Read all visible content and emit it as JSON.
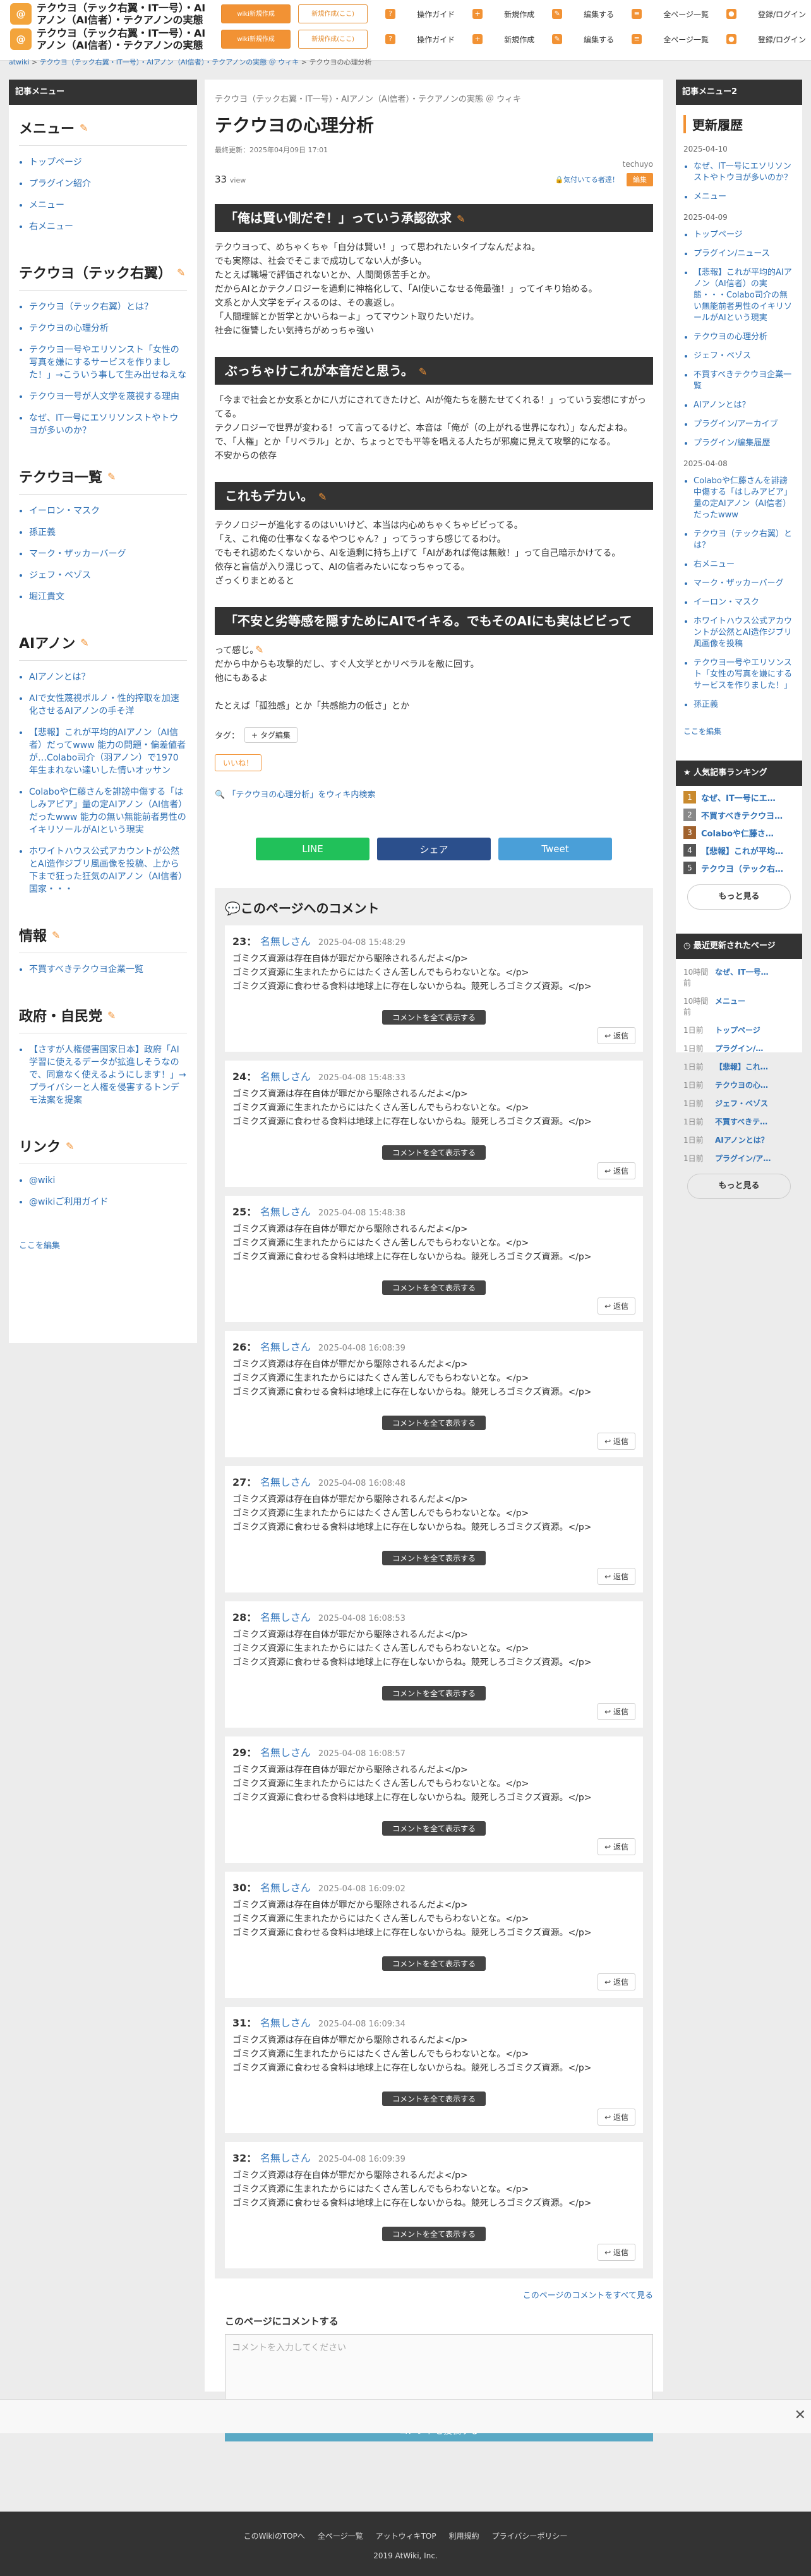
{
  "header": {
    "title": "テクウヨ（テック右翼・IT一号）・AIアノン（AI信者）・テクアノンの実態 ＠ ウィキ",
    "btn1": "wiki新規作成",
    "btn2": "新規作成(ここ)",
    "nav": [
      {
        "label": "操作ガイド",
        "icon": "guide-icon",
        "glyph": "?"
      },
      {
        "label": "新規作成",
        "icon": "plus-icon",
        "glyph": "+"
      },
      {
        "label": "編集する",
        "icon": "edit-icon",
        "glyph": "✎"
      },
      {
        "label": "全ページ一覧",
        "icon": "list-icon",
        "glyph": "≡"
      },
      {
        "label": "登録/ログイン",
        "icon": "user-icon",
        "glyph": "●"
      }
    ]
  },
  "breadcrumb": {
    "root": "atwiki",
    "wiki": "テクウヨ（テック右翼・IT一号）・AIアノン（AI信者）・テクアノンの実態 ＠ ウィキ",
    "page": "テクウヨの心理分析"
  },
  "lside": {
    "head": "記事メニュー",
    "sections": [
      {
        "title": "メニュー",
        "items": [
          "トップページ",
          "プラグイン紹介",
          "メニュー",
          "右メニュー"
        ]
      },
      {
        "title": "テクウヨ（テック右翼）",
        "items": [
          "テクウヨ（テック右翼）とは？",
          "テクウヨの心理分析",
          "テクウヨ一号やエリソンスト「女性の写真を嫌にするサービスを作りました！」→こういう事して生み出せねえな",
          "テクウヨ一号が人文学を蔑視する理由",
          "なぜ、IT一号にエソリソンストやトウヨが多いのか？"
        ]
      },
      {
        "title": "テクウヨ一覧",
        "items": [
          "イーロン・マスク",
          "孫正義",
          "マーク・ザッカーバーグ",
          "ジェフ・ベゾス",
          "堀江貴文"
        ]
      },
      {
        "title": "AIアノン",
        "items": [
          "AIアノンとは？",
          "AIで女性蔑視ポルノ・性的搾取を加速化させるAIアノンの手そ洋",
          "【悲報】これが平均的AIアノン（AI信者）だってwww 能力の問題・偏差値者が…Colabo司介（羽アノン）で1970年生まれない達いした情いオッサン",
          "Colaboや仁藤さんを誹謗中傷する「はしみアビア」量の定AIアノン（AI信者）だったwww 能力の無い無能前者男性のイキリソールがAIという現実",
          "ホワイトハウス公式アカウントが公然とAI造作ジブリ風画像を投稿、上から下まで狂った狂気のAIアノン（AI信者）国家・・・"
        ]
      },
      {
        "title": "情報",
        "items": [
          "不買すべきテクウヨ企業一覧"
        ]
      },
      {
        "title": "政府・自民党",
        "items": [
          "【さすが人権侵害国家日本】政府「AI学習に使えるデータが拡進しそうなので、同意なく使えるようにします！」→プライバシーと人権を侵害するトンデモ法案を提案"
        ]
      },
      {
        "title": "リンク",
        "items": [
          "@wiki",
          "@wikiご利用ガイド"
        ]
      }
    ],
    "edit": "ここを編集"
  },
  "main": {
    "path": "テクウヨ（テック右翼・IT一号）・AIアノン（AI信者）・テクアノンの実態 ＠ ウィキ",
    "title": "テクウヨの心理分析",
    "updated": "最終更新：2025年04月09日 17:01",
    "author": "techuyo",
    "views": "33",
    "views_unit": "view",
    "like_notice": "気付いてる者達！",
    "edit": "編集",
    "sections": [
      {
        "h": "「俺は賢い側だぞ！」っていう承認欲求",
        "p": [
          "テクウヨって、めちゃくちゃ「自分は賢い！」って思われたいタイプなんだよね。",
          "でも実際は、社会でそこまで成功してない人が多い。",
          "たとえば職場で評価されないとか、人間関係苦手とか。",
          "だからAIとかテクノロジーを過剰に神格化して、「AI使いこなせる俺最強！」ってイキり始める。",
          "文系とか人文学をディスるのは、その裏返し。",
          "「人間理解とか哲学とかいらねーよ」ってマウント取りたいだけ。",
          "社会に復讐したい気持ちがめっちゃ強い"
        ]
      },
      {
        "h": "ぶっちゃけこれが本音だと思う。",
        "p": [
          "「今まで社会とか女系とかに八ガにされてきたけど、AIが俺たちを勝たせてくれる！」っていう妄想にすがってる。",
          "テクノロジーで世界が変わる！って言ってるけど、本音は「俺が（の上がれる世界になれ）」なんだよね。",
          "で、「人権」とか「リベラル」とか、ちょっとでも平等を唱える人たちが邪魔に見えて攻撃的になる。",
          "不安からの依存"
        ]
      },
      {
        "h": "これもデカい。",
        "p": [
          "テクノロジーが進化するのはいいけど、本当は内心めちゃくちゃビビってる。",
          "「え、これ俺の仕事なくなるやつじゃん？」ってうっすら感じてるわけ。",
          "でもそれ認めたくないから、AIを過剰に持ち上げて「AIがあれば俺は無敵！」って自己暗示かけてる。",
          "依存と盲信が入り混じって、AIの信者みたいになっちゃってる。",
          "ざっくりまとめると"
        ]
      },
      {
        "h": "「不安と劣等感を隠すためにAIでイキる。でもそのAIにも実はビビってる」",
        "p": [
          "って感じ。",
          "だから中からも攻撃的だし、すぐ人文学とかリベラルを敵に回す。",
          "他にもあるよ",
          "",
          "たとえば「孤独感」とか「共感能力の低さ」とか"
        ]
      }
    ],
    "tag_label": "タグ：",
    "tag_btn": "+ タグ編集",
    "like_btn": "いいね！",
    "wiki_search": "「テクウヨの心理分析」をウィキ内検索",
    "share": [
      {
        "label": "LINE",
        "color": "#21c15a"
      },
      {
        "label": "シェア",
        "color": "#2b4f8c"
      },
      {
        "label": "Tweet",
        "color": "#4a9fd8"
      }
    ]
  },
  "comments": {
    "head": "このページへのコメント",
    "more": "コメントを全て表示する",
    "reply": "返信",
    "body": [
      "ゴミクズ資源は存在自体が罪だから駆除されるんだよ</p>",
      "ゴミクズ資源に生まれたからにはたくさん苦しんでもらわないとな。</p>",
      "ゴミクズ資源に食わせる食料は地球上に存在しないからね。競死しろゴミクズ資源。</p>"
    ],
    "items": [
      {
        "n": "23",
        "name": "名無しさん",
        "t": "2025-04-08 15:48:29"
      },
      {
        "n": "24",
        "name": "名無しさん",
        "t": "2025-04-08 15:48:33"
      },
      {
        "n": "25",
        "name": "名無しさん",
        "t": "2025-04-08 15:48:38"
      },
      {
        "n": "26",
        "name": "名無しさん",
        "t": "2025-04-08 16:08:39"
      },
      {
        "n": "27",
        "name": "名無しさん",
        "t": "2025-04-08 16:08:48"
      },
      {
        "n": "28",
        "name": "名無しさん",
        "t": "2025-04-08 16:08:53"
      },
      {
        "n": "29",
        "name": "名無しさん",
        "t": "2025-04-08 16:08:57"
      },
      {
        "n": "30",
        "name": "名無しさん",
        "t": "2025-04-08 16:09:02"
      },
      {
        "n": "31",
        "name": "名無しさん",
        "t": "2025-04-08 16:09:34"
      },
      {
        "n": "32",
        "name": "名無しさん",
        "t": "2025-04-08 16:09:39"
      }
    ],
    "view_all": "このページのコメントをすべて見る",
    "form_head": "このページにコメントする",
    "placeholder": "コメントを入力してください",
    "submit": "コメントを投稿する"
  },
  "rside": {
    "head": "記事メニュー2",
    "title": "更新履歴",
    "groups": [
      {
        "date": "2025-04-10",
        "items": [
          "なぜ、IT一号にエソリソンストやトウヨが多いのか？",
          "メニュー"
        ]
      },
      {
        "date": "2025-04-09",
        "items": [
          "トップページ",
          "プラグイン/ニュース",
          "【悲報】これが平均的AIアノン（AI信者）の実態・・・Colabo司介の無い無能前者男性のイキリソールがAIという現実",
          "テクウヨの心理分析",
          "ジェフ・ベゾス",
          "不買すべきテクウヨ企業一覧",
          "AIアノンとは？",
          "プラグイン/アーカイブ",
          "プラグイン/編集履歴"
        ]
      },
      {
        "date": "2025-04-08",
        "items": [
          "Colaboや仁藤さんを誹謗中傷する「はしみアビア」量の定AIアノン（AI信者）だったwww",
          "テクウヨ（テック右翼）とは？",
          "右メニュー",
          "マーク・ザッカーバーグ",
          "イーロン・マスク",
          "ホワイトハウス公式アカウントが公然とAI造作ジブリ風画像を投稿",
          "テクウヨ一号やエリソンスト「女性の写真を嫌にするサービスを作りました！」",
          "孫正義"
        ]
      }
    ],
    "edit": "ここを編集",
    "rank_head": "人気記事ランキング",
    "rank": [
      "なぜ、IT一号にエ…",
      "不買すべきテクウヨ…",
      "Colaboや仁藤さ…",
      "【悲報】これが平均…",
      "テクウヨ（テック右…"
    ],
    "rank_more": "もっと見る",
    "recent_head": "最近更新されたページ",
    "recent": [
      {
        "a": "10時間前",
        "b": "なぜ、IT一号…"
      },
      {
        "a": "10時間前",
        "b": "メニュー"
      },
      {
        "a": "1日前",
        "b": "トップページ"
      },
      {
        "a": "1日前",
        "b": "プラグイン/…"
      },
      {
        "a": "1日前",
        "b": "【悲報】これ…"
      },
      {
        "a": "1日前",
        "b": "テクウヨの心…"
      },
      {
        "a": "1日前",
        "b": "ジェフ・ベゾス"
      },
      {
        "a": "1日前",
        "b": "不買すべきテ…"
      },
      {
        "a": "1日前",
        "b": "AIアノンとは？"
      },
      {
        "a": "1日前",
        "b": "プラグイン/ア…"
      }
    ],
    "recent_more": "もっと見る"
  },
  "footer": {
    "links": [
      "このWikiのTOPへ",
      "全ページ一覧",
      "アットウィキTOP",
      "利用規約",
      "プライバシーポリシー"
    ],
    "copy": "2019 AtWiki, Inc."
  },
  "bar_close": "✕"
}
